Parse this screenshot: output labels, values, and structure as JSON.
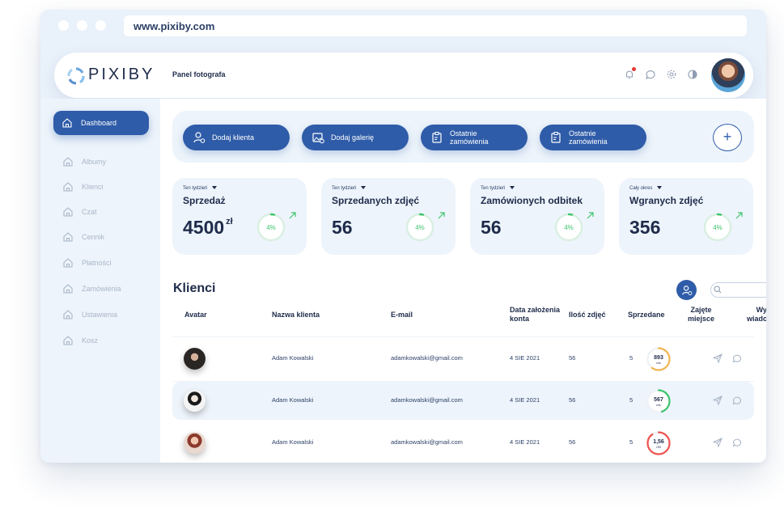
{
  "browser": {
    "url": "www.pixiby.com"
  },
  "header": {
    "logo_text": "PIXIBY",
    "panel_label": "Panel fotografa"
  },
  "sidebar": {
    "items": [
      {
        "label": "Dashboard",
        "icon": "home-icon",
        "active": true
      },
      {
        "label": "Albumy",
        "icon": "home-icon"
      },
      {
        "label": "Klienci",
        "icon": "home-icon"
      },
      {
        "label": "Czat",
        "icon": "home-icon"
      },
      {
        "label": "Cennik",
        "icon": "home-icon"
      },
      {
        "label": "Płatności",
        "icon": "home-icon"
      },
      {
        "label": "Zamówienia",
        "icon": "home-icon"
      },
      {
        "label": "Ustawienia",
        "icon": "home-icon"
      },
      {
        "label": "Kosz",
        "icon": "home-icon"
      }
    ]
  },
  "actions": {
    "buttons": [
      {
        "label": "Dodaj klienta",
        "icon": "add-user-icon"
      },
      {
        "label": "Dodaj galerię",
        "icon": "add-image-icon"
      },
      {
        "label_1": "Ostatnie",
        "label_2": "zamówienia",
        "icon": "clipboard-icon"
      },
      {
        "label_1": "Ostatnie",
        "label_2": "zamówienia",
        "icon": "clipboard-icon"
      }
    ],
    "plus_label": "+"
  },
  "stats": [
    {
      "period": "Ten tydzień",
      "title": "Sprzedaż",
      "value": "4500",
      "unit": "zł",
      "percent_label": "4%",
      "percent": 4
    },
    {
      "period": "Ten tydzień",
      "title": "Sprzedanych zdjęć",
      "value": "56",
      "unit": "",
      "percent_label": "4%",
      "percent": 4
    },
    {
      "period": "Ten tydzień",
      "title": "Zamówionych odbitek",
      "value": "56",
      "unit": "",
      "percent_label": "4%",
      "percent": 4
    },
    {
      "period": "Cały okres",
      "title": "Wgranych zdjęć",
      "value": "356",
      "unit": "",
      "percent_label": "4%",
      "percent": 4
    }
  ],
  "clients": {
    "title": "Klienci",
    "search_placeholder": "",
    "headers": {
      "avatar": "Avatar",
      "name": "Nazwa klienta",
      "email": "E-mail",
      "created_1": "Data założenia",
      "created_2": "konta",
      "photos": "Ilość zdjęć",
      "sold": "Sprzedane",
      "space_1": "Zajęte",
      "space_2": "miejsce",
      "send_1": "Wyślij",
      "send_2": "wiadomość"
    },
    "rows": [
      {
        "name": "Adam Kowalski",
        "email": "adamkowalski@gmail.com",
        "created": "4 SIE 2021",
        "photos": "56",
        "sold": "5",
        "usage_value": "893",
        "usage_unit": "mb",
        "usage_fraction": 0.6,
        "usage_color": "#f3b552"
      },
      {
        "name": "Adam Kowalski",
        "email": "adamkowalski@gmail.com",
        "created": "4 SIE 2021",
        "photos": "56",
        "sold": "5",
        "usage_value": "567",
        "usage_unit": "mb",
        "usage_fraction": 0.45,
        "usage_color": "#3ec46d"
      },
      {
        "name": "Adam Kowalski",
        "email": "adamkowalski@gmail.com",
        "created": "4 SIE 2021",
        "photos": "56",
        "sold": "5",
        "usage_value": "1,56",
        "usage_unit": "GB",
        "usage_fraction": 0.9,
        "usage_color": "#ef5350"
      }
    ]
  },
  "colors": {
    "primary": "#2f5ca8",
    "surface": "#edf4fb",
    "text": "#1e2b4a",
    "success": "#3ec46d"
  }
}
